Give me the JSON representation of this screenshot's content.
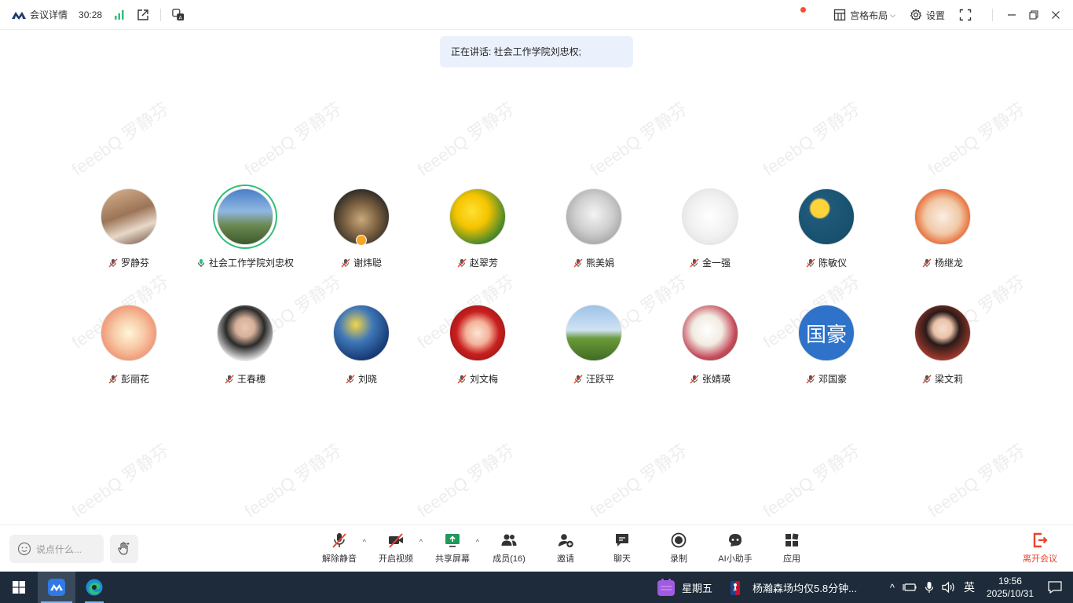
{
  "topbar": {
    "meeting_info_label": "会议详情",
    "elapsed_time": "30:28",
    "layout_label": "宫格布局",
    "settings_label": "设置"
  },
  "speaking_banner": "正在讲话: 社会工作学院刘忠权;",
  "watermark_text": "feeebQ 罗静芬",
  "participants": [
    {
      "name": "罗静芬",
      "mic": "muted"
    },
    {
      "name": "社会工作学院刘忠权",
      "mic": "speaking",
      "active": true
    },
    {
      "name": "谢炜聪",
      "mic": "muted",
      "badge": "host"
    },
    {
      "name": "赵翠芳",
      "mic": "muted"
    },
    {
      "name": "熊美娟",
      "mic": "muted"
    },
    {
      "name": "金一强",
      "mic": "muted"
    },
    {
      "name": "陈敏仪",
      "mic": "muted"
    },
    {
      "name": "杨继龙",
      "mic": "muted"
    },
    {
      "name": "彭丽花",
      "mic": "muted"
    },
    {
      "name": "王春穗",
      "mic": "muted"
    },
    {
      "name": "刘晓",
      "mic": "muted"
    },
    {
      "name": "刘文梅",
      "mic": "muted"
    },
    {
      "name": "汪跃平",
      "mic": "muted"
    },
    {
      "name": "张婧瑛",
      "mic": "muted"
    },
    {
      "name": "邓国豪",
      "mic": "muted",
      "avatar_text": "国豪"
    },
    {
      "name": "梁文莉",
      "mic": "muted"
    }
  ],
  "bottombar": {
    "chat_placeholder": "说点什么...",
    "tools": [
      {
        "label": "解除静音",
        "icon": "mic-muted-icon",
        "caret": true
      },
      {
        "label": "开启视频",
        "icon": "video-off-icon",
        "caret": true
      },
      {
        "label": "共享屏幕",
        "icon": "share-screen-icon",
        "caret": true
      },
      {
        "label": "成员(16)",
        "icon": "members-icon",
        "caret": false
      },
      {
        "label": "邀请",
        "icon": "invite-icon",
        "caret": false
      },
      {
        "label": "聊天",
        "icon": "chat-icon",
        "caret": false
      },
      {
        "label": "录制",
        "icon": "record-icon",
        "caret": false
      },
      {
        "label": "AI小助手",
        "icon": "ai-assistant-icon",
        "caret": false
      },
      {
        "label": "应用",
        "icon": "apps-icon",
        "caret": false
      }
    ],
    "leave_label": "离开会议"
  },
  "taskbar": {
    "weather_label": "星期五",
    "news_label": "杨瀚森场均仅5.8分钟...",
    "ime_label": "英",
    "time": "19:56",
    "date": "2025/10/31"
  },
  "colors": {
    "speaking_ring": "#2fbf7a",
    "banner_bg": "#eaf1fc",
    "leave_red": "#e8442c",
    "taskbar_bg": "#1d2b3a"
  }
}
